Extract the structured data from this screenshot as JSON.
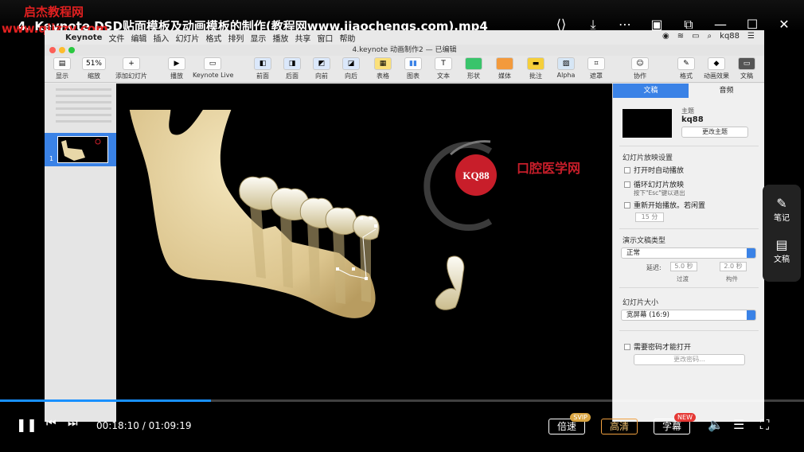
{
  "player": {
    "title": "4. Keynote DSD贴面模板及动画模板的制作(教程网www.jiaochengs.com).mp4",
    "watermark_cn": "启杰教程网",
    "watermark_url": "www.qjjzzy.com",
    "top_icons": [
      "share-icon",
      "download-icon",
      "more-icon",
      "pip-icon",
      "popout-icon",
      "minimize-icon",
      "maximize-icon",
      "close-icon"
    ],
    "current_time": "00:18:10",
    "duration": "01:09:19",
    "progress": 0.262,
    "speed_label": "倍速",
    "speed_badge": "SVIP",
    "quality_label": "高清",
    "subtitle_label": "字幕",
    "subtitle_badge": "NEW",
    "side_panel": {
      "notes_label": "笔记",
      "manuscript_label": "文稿"
    }
  },
  "mac": {
    "menubar": {
      "app": "Keynote",
      "items": [
        "文件",
        "编辑",
        "插入",
        "幻灯片",
        "格式",
        "排列",
        "显示",
        "播放",
        "共享",
        "窗口",
        "帮助"
      ],
      "user": "kq88"
    },
    "window_title": "4.keynote 动画制作2 — 已编辑",
    "toolbar": {
      "view_label": "显示",
      "zoom_value": "51%",
      "zoom_label": "缩放",
      "add_slide_label": "添加幻灯片",
      "play_label": "播放",
      "keynote_live_label": "Keynote Live",
      "front_label": "前面",
      "back_label": "后面",
      "forward_label": "向前",
      "backward_label": "向后",
      "table_label": "表格",
      "chart_label": "图表",
      "text_label": "文本",
      "shape_label": "形状",
      "media_label": "媒体",
      "comment_label": "批注",
      "alpha_label": "Alpha",
      "mask_label": "遮罩",
      "collaborate_label": "协作",
      "format_label": "格式",
      "animate_label": "动画效果",
      "document_label": "文稿"
    },
    "slide": {
      "thumb_number": "1",
      "logo_text": "KQ88",
      "brand_text": "口腔医学网"
    },
    "inspector": {
      "tab_document": "文稿",
      "tab_audio": "音频",
      "theme_label": "主题",
      "theme_name": "kq88",
      "change_theme": "更改主题",
      "slideshow_settings": "幻灯片放映设置",
      "autoplay": "打开时自动播放",
      "loop": "循环幻灯片放映",
      "loop_hint": "按下\"Esc\"键以退出",
      "restart_idle": "重新开始播放。若闲置",
      "idle_minutes": "15 分",
      "presentation_type": "演示文稿类型",
      "presentation_value": "正常",
      "delay_label": "延迟:",
      "transition_delay": "5.0 秒",
      "transition_label": "过渡",
      "build_delay": "2.0 秒",
      "build_label": "构件",
      "slide_size_label": "幻灯片大小",
      "slide_size_value": "宽屏幕 (16:9)",
      "require_password": "需要密码才能打开",
      "change_password": "更改密码..."
    }
  },
  "colors": {
    "accent": "#3a82e6",
    "progress": "#1890ff",
    "watermark": "#e02020",
    "logo_red": "#c81e2a",
    "bone": "#e8d7a8"
  }
}
